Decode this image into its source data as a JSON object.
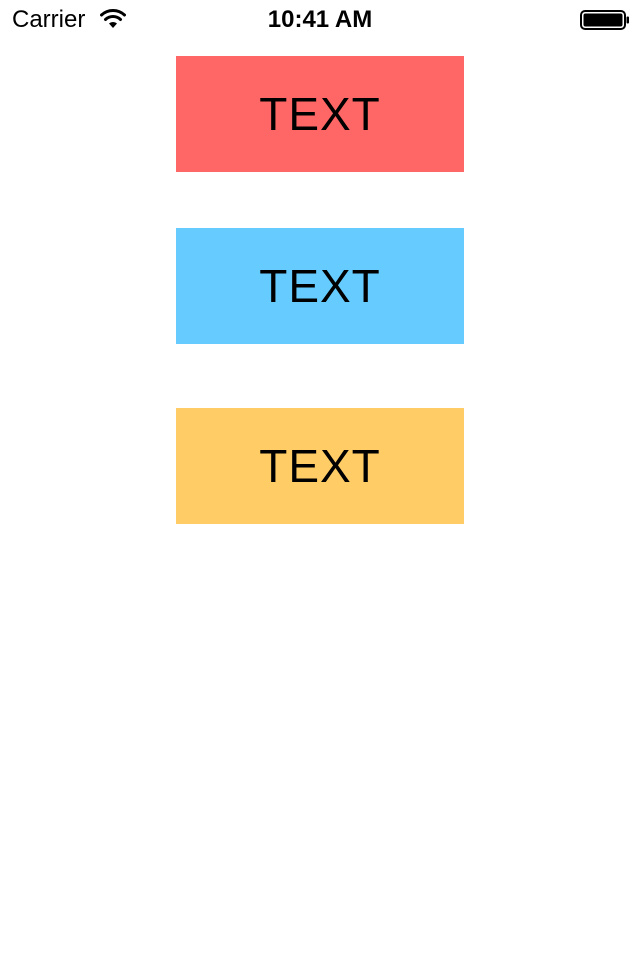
{
  "status_bar": {
    "carrier": "Carrier",
    "time": "10:41 AM",
    "wifi_icon": "wifi-icon",
    "battery_icon": "battery-icon",
    "battery_level": 1.0
  },
  "blocks": [
    {
      "label": "TEXT",
      "color": "#ff6666"
    },
    {
      "label": "TEXT",
      "color": "#66ccff"
    },
    {
      "label": "TEXT",
      "color": "#ffcc66"
    }
  ]
}
